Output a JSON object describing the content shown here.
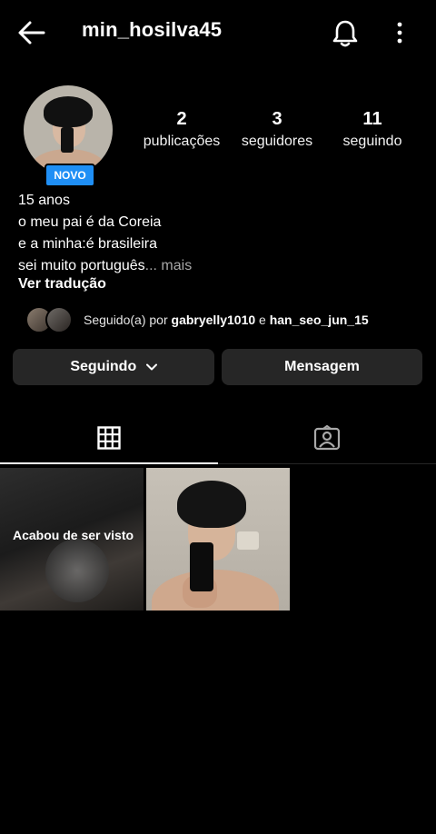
{
  "header": {
    "username": "min_hosilva45",
    "back_icon": "arrow-left-icon",
    "notifications_icon": "bell-icon",
    "more_icon": "more-vertical-icon"
  },
  "profile": {
    "badge": "NOVO",
    "stats": [
      {
        "value": "2",
        "label": "publicações"
      },
      {
        "value": "3",
        "label": "seguidores"
      },
      {
        "value": "11",
        "label": "seguindo"
      }
    ],
    "bio": [
      "15 anos",
      "o meu pai é da Coreia",
      "e a minha:é brasileira",
      "sei muito português"
    ],
    "bio_more": "... mais",
    "translate": "Ver tradução",
    "followed_by_prefix": "Seguido(a) por ",
    "followed_by_user1": "gabryelly1010",
    "followed_by_join": " e ",
    "followed_by_user2": "han_seo_jun_15"
  },
  "actions": {
    "following_label": "Seguindo",
    "message_label": "Mensagem"
  },
  "tabs": {
    "grid_icon": "grid-icon",
    "tagged_icon": "tagged-person-icon"
  },
  "posts": [
    {
      "overlay": "Acabou de ser visto"
    },
    {
      "overlay": ""
    }
  ],
  "colors": {
    "background": "#000000",
    "button": "#262626",
    "badge": "#1f8ff5"
  }
}
